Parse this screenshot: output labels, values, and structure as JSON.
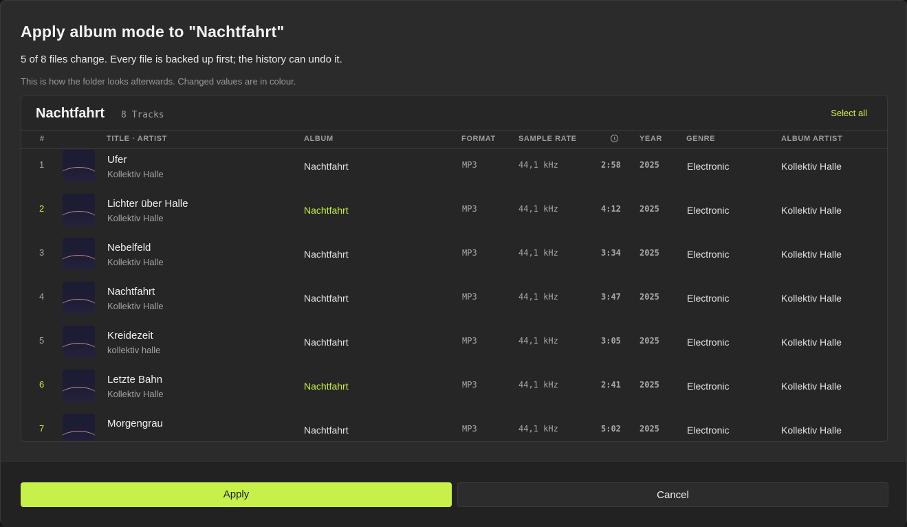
{
  "dialog": {
    "title": "Apply album mode to \"Nachtfahrt\"",
    "subtitle": "5 of 8 files change. Every file is backed up first; the history can undo it.",
    "hint": "This is how the folder looks afterwards. Changed values are in colour."
  },
  "panel": {
    "album_name": "Nachtfahrt",
    "track_count": "8 Tracks",
    "select_all": "Select all"
  },
  "columns": {
    "num": "#",
    "title_artist": "TITLE · ARTIST",
    "album": "ALBUM",
    "format": "FORMAT",
    "sample_rate": "SAMPLE RATE",
    "duration_icon": "clock-icon",
    "year": "YEAR",
    "genre": "GENRE",
    "album_artist": "ALBUM ARTIST"
  },
  "tracks": [
    {
      "num": "1",
      "title": "Ufer",
      "artist": "Kollektiv Halle",
      "album": "Nachtfahrt",
      "album_changed": false,
      "num_changed": false,
      "format": "MP3",
      "sample_rate": "44,1 kHz",
      "duration": "2:58",
      "year": "2025",
      "genre": "Electronic",
      "album_artist": "Kollektiv Halle"
    },
    {
      "num": "2",
      "title": "Lichter über Halle",
      "artist": "Kollektiv Halle",
      "album": "Nachtfahrt",
      "album_changed": true,
      "num_changed": true,
      "format": "MP3",
      "sample_rate": "44,1 kHz",
      "duration": "4:12",
      "year": "2025",
      "genre": "Electronic",
      "album_artist": "Kollektiv Halle"
    },
    {
      "num": "3",
      "title": "Nebelfeld",
      "artist": "Kollektiv Halle",
      "album": "Nachtfahrt",
      "album_changed": false,
      "num_changed": false,
      "format": "MP3",
      "sample_rate": "44,1 kHz",
      "duration": "3:34",
      "year": "2025",
      "genre": "Electronic",
      "album_artist": "Kollektiv Halle"
    },
    {
      "num": "4",
      "title": "Nachtfahrt",
      "artist": "Kollektiv Halle",
      "album": "Nachtfahrt",
      "album_changed": false,
      "num_changed": false,
      "format": "MP3",
      "sample_rate": "44,1 kHz",
      "duration": "3:47",
      "year": "2025",
      "genre": "Electronic",
      "album_artist": "Kollektiv Halle"
    },
    {
      "num": "5",
      "title": "Kreidezeit",
      "artist": "kollektiv halle",
      "album": "Nachtfahrt",
      "album_changed": false,
      "num_changed": false,
      "format": "MP3",
      "sample_rate": "44,1 kHz",
      "duration": "3:05",
      "year": "2025",
      "genre": "Electronic",
      "album_artist": "Kollektiv Halle"
    },
    {
      "num": "6",
      "title": "Letzte Bahn",
      "artist": "Kollektiv Halle",
      "album": "Nachtfahrt",
      "album_changed": true,
      "num_changed": true,
      "format": "MP3",
      "sample_rate": "44,1 kHz",
      "duration": "2:41",
      "year": "2025",
      "genre": "Electronic",
      "album_artist": "Kollektiv Halle"
    },
    {
      "num": "7",
      "title": "Morgengrau",
      "artist": "",
      "album": "Nachtfahrt",
      "album_changed": false,
      "num_changed": true,
      "format": "MP3",
      "sample_rate": "44,1 kHz",
      "duration": "5:02",
      "year": "2025",
      "genre": "Electronic",
      "album_artist": "Kollektiv Halle"
    }
  ],
  "footer": {
    "apply_label": "Apply",
    "cancel_label": "Cancel"
  },
  "colors": {
    "accent": "#c8f04a",
    "changed": "#c8ec48"
  }
}
